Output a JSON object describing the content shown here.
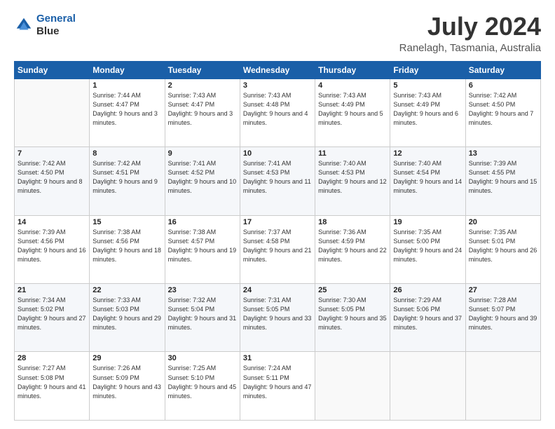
{
  "header": {
    "logo_line1": "General",
    "logo_line2": "Blue",
    "month": "July 2024",
    "location": "Ranelagh, Tasmania, Australia"
  },
  "days_of_week": [
    "Sunday",
    "Monday",
    "Tuesday",
    "Wednesday",
    "Thursday",
    "Friday",
    "Saturday"
  ],
  "weeks": [
    [
      {
        "day": "",
        "sunrise": "",
        "sunset": "",
        "daylight": ""
      },
      {
        "day": "1",
        "sunrise": "Sunrise: 7:44 AM",
        "sunset": "Sunset: 4:47 PM",
        "daylight": "Daylight: 9 hours and 3 minutes."
      },
      {
        "day": "2",
        "sunrise": "Sunrise: 7:43 AM",
        "sunset": "Sunset: 4:47 PM",
        "daylight": "Daylight: 9 hours and 3 minutes."
      },
      {
        "day": "3",
        "sunrise": "Sunrise: 7:43 AM",
        "sunset": "Sunset: 4:48 PM",
        "daylight": "Daylight: 9 hours and 4 minutes."
      },
      {
        "day": "4",
        "sunrise": "Sunrise: 7:43 AM",
        "sunset": "Sunset: 4:49 PM",
        "daylight": "Daylight: 9 hours and 5 minutes."
      },
      {
        "day": "5",
        "sunrise": "Sunrise: 7:43 AM",
        "sunset": "Sunset: 4:49 PM",
        "daylight": "Daylight: 9 hours and 6 minutes."
      },
      {
        "day": "6",
        "sunrise": "Sunrise: 7:42 AM",
        "sunset": "Sunset: 4:50 PM",
        "daylight": "Daylight: 9 hours and 7 minutes."
      }
    ],
    [
      {
        "day": "7",
        "sunrise": "Sunrise: 7:42 AM",
        "sunset": "Sunset: 4:50 PM",
        "daylight": "Daylight: 9 hours and 8 minutes."
      },
      {
        "day": "8",
        "sunrise": "Sunrise: 7:42 AM",
        "sunset": "Sunset: 4:51 PM",
        "daylight": "Daylight: 9 hours and 9 minutes."
      },
      {
        "day": "9",
        "sunrise": "Sunrise: 7:41 AM",
        "sunset": "Sunset: 4:52 PM",
        "daylight": "Daylight: 9 hours and 10 minutes."
      },
      {
        "day": "10",
        "sunrise": "Sunrise: 7:41 AM",
        "sunset": "Sunset: 4:53 PM",
        "daylight": "Daylight: 9 hours and 11 minutes."
      },
      {
        "day": "11",
        "sunrise": "Sunrise: 7:40 AM",
        "sunset": "Sunset: 4:53 PM",
        "daylight": "Daylight: 9 hours and 12 minutes."
      },
      {
        "day": "12",
        "sunrise": "Sunrise: 7:40 AM",
        "sunset": "Sunset: 4:54 PM",
        "daylight": "Daylight: 9 hours and 14 minutes."
      },
      {
        "day": "13",
        "sunrise": "Sunrise: 7:39 AM",
        "sunset": "Sunset: 4:55 PM",
        "daylight": "Daylight: 9 hours and 15 minutes."
      }
    ],
    [
      {
        "day": "14",
        "sunrise": "Sunrise: 7:39 AM",
        "sunset": "Sunset: 4:56 PM",
        "daylight": "Daylight: 9 hours and 16 minutes."
      },
      {
        "day": "15",
        "sunrise": "Sunrise: 7:38 AM",
        "sunset": "Sunset: 4:56 PM",
        "daylight": "Daylight: 9 hours and 18 minutes."
      },
      {
        "day": "16",
        "sunrise": "Sunrise: 7:38 AM",
        "sunset": "Sunset: 4:57 PM",
        "daylight": "Daylight: 9 hours and 19 minutes."
      },
      {
        "day": "17",
        "sunrise": "Sunrise: 7:37 AM",
        "sunset": "Sunset: 4:58 PM",
        "daylight": "Daylight: 9 hours and 21 minutes."
      },
      {
        "day": "18",
        "sunrise": "Sunrise: 7:36 AM",
        "sunset": "Sunset: 4:59 PM",
        "daylight": "Daylight: 9 hours and 22 minutes."
      },
      {
        "day": "19",
        "sunrise": "Sunrise: 7:35 AM",
        "sunset": "Sunset: 5:00 PM",
        "daylight": "Daylight: 9 hours and 24 minutes."
      },
      {
        "day": "20",
        "sunrise": "Sunrise: 7:35 AM",
        "sunset": "Sunset: 5:01 PM",
        "daylight": "Daylight: 9 hours and 26 minutes."
      }
    ],
    [
      {
        "day": "21",
        "sunrise": "Sunrise: 7:34 AM",
        "sunset": "Sunset: 5:02 PM",
        "daylight": "Daylight: 9 hours and 27 minutes."
      },
      {
        "day": "22",
        "sunrise": "Sunrise: 7:33 AM",
        "sunset": "Sunset: 5:03 PM",
        "daylight": "Daylight: 9 hours and 29 minutes."
      },
      {
        "day": "23",
        "sunrise": "Sunrise: 7:32 AM",
        "sunset": "Sunset: 5:04 PM",
        "daylight": "Daylight: 9 hours and 31 minutes."
      },
      {
        "day": "24",
        "sunrise": "Sunrise: 7:31 AM",
        "sunset": "Sunset: 5:05 PM",
        "daylight": "Daylight: 9 hours and 33 minutes."
      },
      {
        "day": "25",
        "sunrise": "Sunrise: 7:30 AM",
        "sunset": "Sunset: 5:05 PM",
        "daylight": "Daylight: 9 hours and 35 minutes."
      },
      {
        "day": "26",
        "sunrise": "Sunrise: 7:29 AM",
        "sunset": "Sunset: 5:06 PM",
        "daylight": "Daylight: 9 hours and 37 minutes."
      },
      {
        "day": "27",
        "sunrise": "Sunrise: 7:28 AM",
        "sunset": "Sunset: 5:07 PM",
        "daylight": "Daylight: 9 hours and 39 minutes."
      }
    ],
    [
      {
        "day": "28",
        "sunrise": "Sunrise: 7:27 AM",
        "sunset": "Sunset: 5:08 PM",
        "daylight": "Daylight: 9 hours and 41 minutes."
      },
      {
        "day": "29",
        "sunrise": "Sunrise: 7:26 AM",
        "sunset": "Sunset: 5:09 PM",
        "daylight": "Daylight: 9 hours and 43 minutes."
      },
      {
        "day": "30",
        "sunrise": "Sunrise: 7:25 AM",
        "sunset": "Sunset: 5:10 PM",
        "daylight": "Daylight: 9 hours and 45 minutes."
      },
      {
        "day": "31",
        "sunrise": "Sunrise: 7:24 AM",
        "sunset": "Sunset: 5:11 PM",
        "daylight": "Daylight: 9 hours and 47 minutes."
      },
      {
        "day": "",
        "sunrise": "",
        "sunset": "",
        "daylight": ""
      },
      {
        "day": "",
        "sunrise": "",
        "sunset": "",
        "daylight": ""
      },
      {
        "day": "",
        "sunrise": "",
        "sunset": "",
        "daylight": ""
      }
    ]
  ]
}
